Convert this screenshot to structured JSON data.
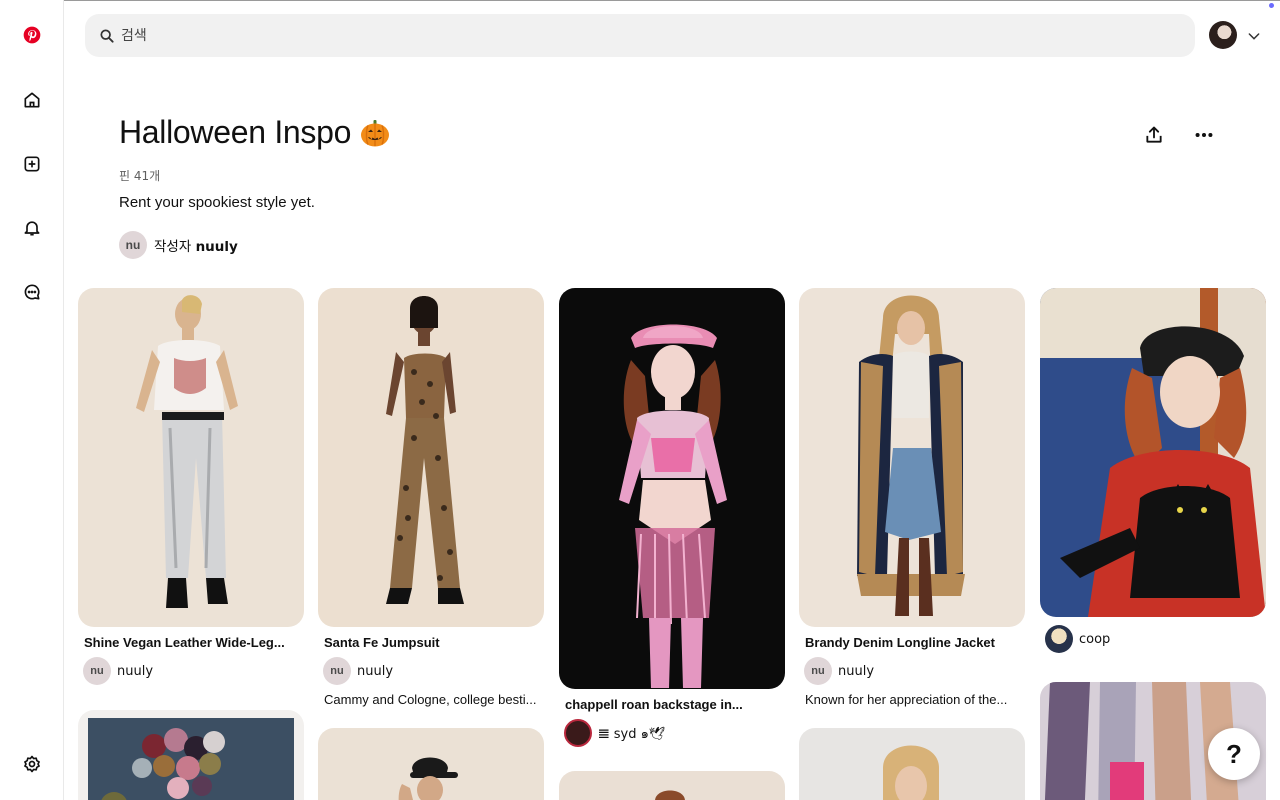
{
  "search": {
    "placeholder": "검색"
  },
  "board": {
    "title": "Halloween Inspo",
    "pin_count": "핀 41개",
    "description": "Rent your spookiest style yet.",
    "creator_prefix": "작성자",
    "creator_name": "nuuly",
    "creator_initials": "nu"
  },
  "pins": [
    {
      "title": "Shine Vegan Leather Wide-Leg...",
      "author": "nuuly",
      "initials": "nu",
      "description": ""
    },
    {
      "title": "Santa Fe Jumpsuit",
      "author": "nuuly",
      "initials": "nu",
      "description": "Cammy and Cologne, college besti..."
    },
    {
      "title": "chappell roan backstage in...",
      "author": "𝌆 syd ๑🕊",
      "initials": "",
      "description": ""
    },
    {
      "title": "Brandy Denim Longline Jacket",
      "author": "nuuly",
      "initials": "nu",
      "description": "Known for her appreciation of the..."
    },
    {
      "title": "",
      "author": "coop",
      "initials": "",
      "description": ""
    }
  ],
  "help": {
    "label": "?"
  },
  "colors": {
    "brand": "#e60023",
    "search_bg": "#f1f1f1",
    "avatar_bg": "#e0d6d8"
  },
  "icons": [
    "pinterest-logo-icon",
    "home-icon",
    "create-icon",
    "notifications-icon",
    "messages-icon",
    "settings-icon",
    "search-icon",
    "chevron-down-icon",
    "share-icon",
    "more-icon"
  ]
}
